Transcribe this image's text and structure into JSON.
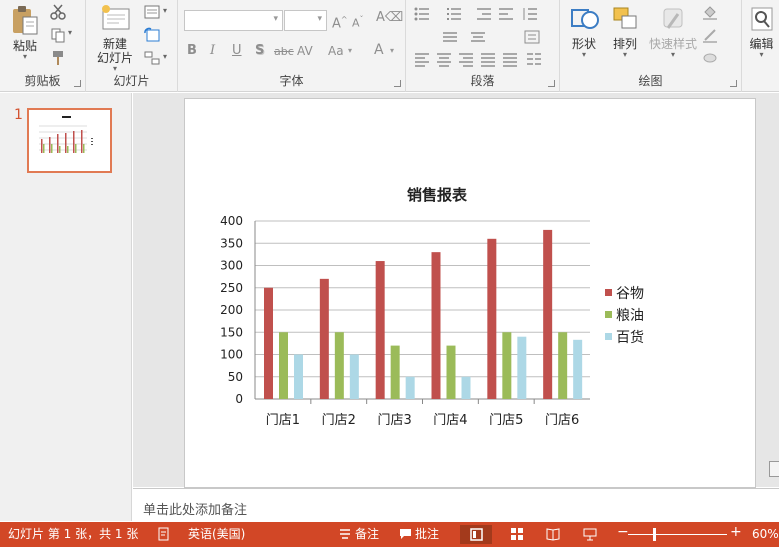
{
  "ribbon": {
    "clipboard": {
      "label": "剪贴板",
      "paste_label": "粘贴"
    },
    "slides": {
      "label": "幻灯片",
      "new_slide_line1": "新建",
      "new_slide_line2": "幻灯片"
    },
    "font": {
      "label": "字体",
      "font_name": "",
      "font_size": "",
      "bold": "B",
      "italic": "I",
      "underline": "U",
      "shadow": "S",
      "strike": "abc",
      "spacing": "AV",
      "case": "Aa",
      "color": "A"
    },
    "paragraph": {
      "label": "段落"
    },
    "drawing": {
      "label": "绘图",
      "shapes_label": "形状",
      "arrange_label": "排列",
      "quick_styles_label": "快速样式"
    },
    "editing": {
      "label": "编辑"
    }
  },
  "thumbnail": {
    "number": "1"
  },
  "chart_data": {
    "type": "bar",
    "title": "销售报表",
    "categories": [
      "门店1",
      "门店2",
      "门店3",
      "门店4",
      "门店5",
      "门店6"
    ],
    "series": [
      {
        "name": "谷物",
        "color": "#c0504d",
        "values": [
          250,
          270,
          310,
          330,
          360,
          380
        ]
      },
      {
        "name": "粮油",
        "color": "#9bbb59",
        "values": [
          150,
          150,
          120,
          120,
          150,
          150
        ]
      },
      {
        "name": "百货",
        "color": "#add8e6",
        "values": [
          100,
          100,
          50,
          50,
          140,
          133
        ]
      }
    ],
    "ylim": [
      0,
      400
    ],
    "yticks": [
      "0",
      "50",
      "100",
      "150",
      "200",
      "250",
      "300",
      "350",
      "400"
    ],
    "grid": true,
    "legend": "right"
  },
  "notes": {
    "placeholder": "单击此处添加备注"
  },
  "status": {
    "slide_info": "幻灯片 第 1 张，共 1 张",
    "language": "英语(美国)",
    "notes_label": "备注",
    "comments_label": "批注",
    "zoom": "60%",
    "minus": "−",
    "plus": "+"
  }
}
